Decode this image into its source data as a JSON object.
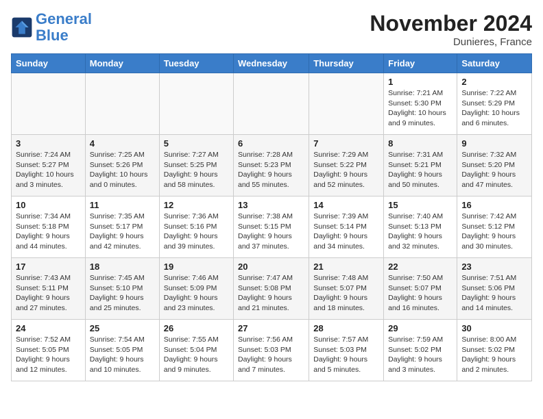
{
  "header": {
    "logo_line1": "General",
    "logo_line2": "Blue",
    "month_title": "November 2024",
    "location": "Dunieres, France"
  },
  "weekdays": [
    "Sunday",
    "Monday",
    "Tuesday",
    "Wednesday",
    "Thursday",
    "Friday",
    "Saturday"
  ],
  "weeks": [
    [
      {
        "day": "",
        "info": ""
      },
      {
        "day": "",
        "info": ""
      },
      {
        "day": "",
        "info": ""
      },
      {
        "day": "",
        "info": ""
      },
      {
        "day": "",
        "info": ""
      },
      {
        "day": "1",
        "info": "Sunrise: 7:21 AM\nSunset: 5:30 PM\nDaylight: 10 hours and 9 minutes."
      },
      {
        "day": "2",
        "info": "Sunrise: 7:22 AM\nSunset: 5:29 PM\nDaylight: 10 hours and 6 minutes."
      }
    ],
    [
      {
        "day": "3",
        "info": "Sunrise: 7:24 AM\nSunset: 5:27 PM\nDaylight: 10 hours and 3 minutes."
      },
      {
        "day": "4",
        "info": "Sunrise: 7:25 AM\nSunset: 5:26 PM\nDaylight: 10 hours and 0 minutes."
      },
      {
        "day": "5",
        "info": "Sunrise: 7:27 AM\nSunset: 5:25 PM\nDaylight: 9 hours and 58 minutes."
      },
      {
        "day": "6",
        "info": "Sunrise: 7:28 AM\nSunset: 5:23 PM\nDaylight: 9 hours and 55 minutes."
      },
      {
        "day": "7",
        "info": "Sunrise: 7:29 AM\nSunset: 5:22 PM\nDaylight: 9 hours and 52 minutes."
      },
      {
        "day": "8",
        "info": "Sunrise: 7:31 AM\nSunset: 5:21 PM\nDaylight: 9 hours and 50 minutes."
      },
      {
        "day": "9",
        "info": "Sunrise: 7:32 AM\nSunset: 5:20 PM\nDaylight: 9 hours and 47 minutes."
      }
    ],
    [
      {
        "day": "10",
        "info": "Sunrise: 7:34 AM\nSunset: 5:18 PM\nDaylight: 9 hours and 44 minutes."
      },
      {
        "day": "11",
        "info": "Sunrise: 7:35 AM\nSunset: 5:17 PM\nDaylight: 9 hours and 42 minutes."
      },
      {
        "day": "12",
        "info": "Sunrise: 7:36 AM\nSunset: 5:16 PM\nDaylight: 9 hours and 39 minutes."
      },
      {
        "day": "13",
        "info": "Sunrise: 7:38 AM\nSunset: 5:15 PM\nDaylight: 9 hours and 37 minutes."
      },
      {
        "day": "14",
        "info": "Sunrise: 7:39 AM\nSunset: 5:14 PM\nDaylight: 9 hours and 34 minutes."
      },
      {
        "day": "15",
        "info": "Sunrise: 7:40 AM\nSunset: 5:13 PM\nDaylight: 9 hours and 32 minutes."
      },
      {
        "day": "16",
        "info": "Sunrise: 7:42 AM\nSunset: 5:12 PM\nDaylight: 9 hours and 30 minutes."
      }
    ],
    [
      {
        "day": "17",
        "info": "Sunrise: 7:43 AM\nSunset: 5:11 PM\nDaylight: 9 hours and 27 minutes."
      },
      {
        "day": "18",
        "info": "Sunrise: 7:45 AM\nSunset: 5:10 PM\nDaylight: 9 hours and 25 minutes."
      },
      {
        "day": "19",
        "info": "Sunrise: 7:46 AM\nSunset: 5:09 PM\nDaylight: 9 hours and 23 minutes."
      },
      {
        "day": "20",
        "info": "Sunrise: 7:47 AM\nSunset: 5:08 PM\nDaylight: 9 hours and 21 minutes."
      },
      {
        "day": "21",
        "info": "Sunrise: 7:48 AM\nSunset: 5:07 PM\nDaylight: 9 hours and 18 minutes."
      },
      {
        "day": "22",
        "info": "Sunrise: 7:50 AM\nSunset: 5:07 PM\nDaylight: 9 hours and 16 minutes."
      },
      {
        "day": "23",
        "info": "Sunrise: 7:51 AM\nSunset: 5:06 PM\nDaylight: 9 hours and 14 minutes."
      }
    ],
    [
      {
        "day": "24",
        "info": "Sunrise: 7:52 AM\nSunset: 5:05 PM\nDaylight: 9 hours and 12 minutes."
      },
      {
        "day": "25",
        "info": "Sunrise: 7:54 AM\nSunset: 5:05 PM\nDaylight: 9 hours and 10 minutes."
      },
      {
        "day": "26",
        "info": "Sunrise: 7:55 AM\nSunset: 5:04 PM\nDaylight: 9 hours and 9 minutes."
      },
      {
        "day": "27",
        "info": "Sunrise: 7:56 AM\nSunset: 5:03 PM\nDaylight: 9 hours and 7 minutes."
      },
      {
        "day": "28",
        "info": "Sunrise: 7:57 AM\nSunset: 5:03 PM\nDaylight: 9 hours and 5 minutes."
      },
      {
        "day": "29",
        "info": "Sunrise: 7:59 AM\nSunset: 5:02 PM\nDaylight: 9 hours and 3 minutes."
      },
      {
        "day": "30",
        "info": "Sunrise: 8:00 AM\nSunset: 5:02 PM\nDaylight: 9 hours and 2 minutes."
      }
    ]
  ]
}
